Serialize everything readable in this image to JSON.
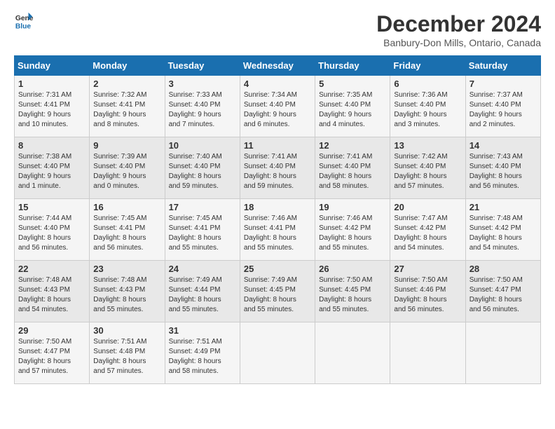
{
  "logo": {
    "line1": "General",
    "line2": "Blue"
  },
  "title": "December 2024",
  "subtitle": "Banbury-Don Mills, Ontario, Canada",
  "days_of_week": [
    "Sunday",
    "Monday",
    "Tuesday",
    "Wednesday",
    "Thursday",
    "Friday",
    "Saturday"
  ],
  "weeks": [
    [
      {
        "num": "1",
        "info": "Sunrise: 7:31 AM\nSunset: 4:41 PM\nDaylight: 9 hours\nand 10 minutes."
      },
      {
        "num": "2",
        "info": "Sunrise: 7:32 AM\nSunset: 4:41 PM\nDaylight: 9 hours\nand 8 minutes."
      },
      {
        "num": "3",
        "info": "Sunrise: 7:33 AM\nSunset: 4:40 PM\nDaylight: 9 hours\nand 7 minutes."
      },
      {
        "num": "4",
        "info": "Sunrise: 7:34 AM\nSunset: 4:40 PM\nDaylight: 9 hours\nand 6 minutes."
      },
      {
        "num": "5",
        "info": "Sunrise: 7:35 AM\nSunset: 4:40 PM\nDaylight: 9 hours\nand 4 minutes."
      },
      {
        "num": "6",
        "info": "Sunrise: 7:36 AM\nSunset: 4:40 PM\nDaylight: 9 hours\nand 3 minutes."
      },
      {
        "num": "7",
        "info": "Sunrise: 7:37 AM\nSunset: 4:40 PM\nDaylight: 9 hours\nand 2 minutes."
      }
    ],
    [
      {
        "num": "8",
        "info": "Sunrise: 7:38 AM\nSunset: 4:40 PM\nDaylight: 9 hours\nand 1 minute."
      },
      {
        "num": "9",
        "info": "Sunrise: 7:39 AM\nSunset: 4:40 PM\nDaylight: 9 hours\nand 0 minutes."
      },
      {
        "num": "10",
        "info": "Sunrise: 7:40 AM\nSunset: 4:40 PM\nDaylight: 8 hours\nand 59 minutes."
      },
      {
        "num": "11",
        "info": "Sunrise: 7:41 AM\nSunset: 4:40 PM\nDaylight: 8 hours\nand 59 minutes."
      },
      {
        "num": "12",
        "info": "Sunrise: 7:41 AM\nSunset: 4:40 PM\nDaylight: 8 hours\nand 58 minutes."
      },
      {
        "num": "13",
        "info": "Sunrise: 7:42 AM\nSunset: 4:40 PM\nDaylight: 8 hours\nand 57 minutes."
      },
      {
        "num": "14",
        "info": "Sunrise: 7:43 AM\nSunset: 4:40 PM\nDaylight: 8 hours\nand 56 minutes."
      }
    ],
    [
      {
        "num": "15",
        "info": "Sunrise: 7:44 AM\nSunset: 4:40 PM\nDaylight: 8 hours\nand 56 minutes."
      },
      {
        "num": "16",
        "info": "Sunrise: 7:45 AM\nSunset: 4:41 PM\nDaylight: 8 hours\nand 56 minutes."
      },
      {
        "num": "17",
        "info": "Sunrise: 7:45 AM\nSunset: 4:41 PM\nDaylight: 8 hours\nand 55 minutes."
      },
      {
        "num": "18",
        "info": "Sunrise: 7:46 AM\nSunset: 4:41 PM\nDaylight: 8 hours\nand 55 minutes."
      },
      {
        "num": "19",
        "info": "Sunrise: 7:46 AM\nSunset: 4:42 PM\nDaylight: 8 hours\nand 55 minutes."
      },
      {
        "num": "20",
        "info": "Sunrise: 7:47 AM\nSunset: 4:42 PM\nDaylight: 8 hours\nand 54 minutes."
      },
      {
        "num": "21",
        "info": "Sunrise: 7:48 AM\nSunset: 4:42 PM\nDaylight: 8 hours\nand 54 minutes."
      }
    ],
    [
      {
        "num": "22",
        "info": "Sunrise: 7:48 AM\nSunset: 4:43 PM\nDaylight: 8 hours\nand 54 minutes."
      },
      {
        "num": "23",
        "info": "Sunrise: 7:48 AM\nSunset: 4:43 PM\nDaylight: 8 hours\nand 55 minutes."
      },
      {
        "num": "24",
        "info": "Sunrise: 7:49 AM\nSunset: 4:44 PM\nDaylight: 8 hours\nand 55 minutes."
      },
      {
        "num": "25",
        "info": "Sunrise: 7:49 AM\nSunset: 4:45 PM\nDaylight: 8 hours\nand 55 minutes."
      },
      {
        "num": "26",
        "info": "Sunrise: 7:50 AM\nSunset: 4:45 PM\nDaylight: 8 hours\nand 55 minutes."
      },
      {
        "num": "27",
        "info": "Sunrise: 7:50 AM\nSunset: 4:46 PM\nDaylight: 8 hours\nand 56 minutes."
      },
      {
        "num": "28",
        "info": "Sunrise: 7:50 AM\nSunset: 4:47 PM\nDaylight: 8 hours\nand 56 minutes."
      }
    ],
    [
      {
        "num": "29",
        "info": "Sunrise: 7:50 AM\nSunset: 4:47 PM\nDaylight: 8 hours\nand 57 minutes."
      },
      {
        "num": "30",
        "info": "Sunrise: 7:51 AM\nSunset: 4:48 PM\nDaylight: 8 hours\nand 57 minutes."
      },
      {
        "num": "31",
        "info": "Sunrise: 7:51 AM\nSunset: 4:49 PM\nDaylight: 8 hours\nand 58 minutes."
      },
      {
        "num": "",
        "info": ""
      },
      {
        "num": "",
        "info": ""
      },
      {
        "num": "",
        "info": ""
      },
      {
        "num": "",
        "info": ""
      }
    ]
  ]
}
